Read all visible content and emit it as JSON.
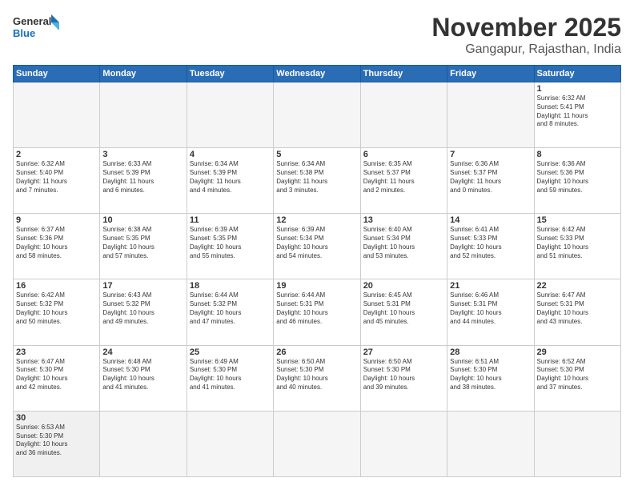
{
  "header": {
    "logo_general": "General",
    "logo_blue": "Blue",
    "month_title": "November 2025",
    "location": "Gangapur, Rajasthan, India"
  },
  "weekdays": [
    "Sunday",
    "Monday",
    "Tuesday",
    "Wednesday",
    "Thursday",
    "Friday",
    "Saturday"
  ],
  "weeks": [
    [
      {
        "day": "",
        "info": ""
      },
      {
        "day": "",
        "info": ""
      },
      {
        "day": "",
        "info": ""
      },
      {
        "day": "",
        "info": ""
      },
      {
        "day": "",
        "info": ""
      },
      {
        "day": "",
        "info": ""
      },
      {
        "day": "1",
        "info": "Sunrise: 6:32 AM\nSunset: 5:41 PM\nDaylight: 11 hours\nand 8 minutes."
      }
    ],
    [
      {
        "day": "2",
        "info": "Sunrise: 6:32 AM\nSunset: 5:40 PM\nDaylight: 11 hours\nand 7 minutes."
      },
      {
        "day": "3",
        "info": "Sunrise: 6:33 AM\nSunset: 5:39 PM\nDaylight: 11 hours\nand 6 minutes."
      },
      {
        "day": "4",
        "info": "Sunrise: 6:34 AM\nSunset: 5:39 PM\nDaylight: 11 hours\nand 4 minutes."
      },
      {
        "day": "5",
        "info": "Sunrise: 6:34 AM\nSunset: 5:38 PM\nDaylight: 11 hours\nand 3 minutes."
      },
      {
        "day": "6",
        "info": "Sunrise: 6:35 AM\nSunset: 5:37 PM\nDaylight: 11 hours\nand 2 minutes."
      },
      {
        "day": "7",
        "info": "Sunrise: 6:36 AM\nSunset: 5:37 PM\nDaylight: 11 hours\nand 0 minutes."
      },
      {
        "day": "8",
        "info": "Sunrise: 6:36 AM\nSunset: 5:36 PM\nDaylight: 10 hours\nand 59 minutes."
      }
    ],
    [
      {
        "day": "9",
        "info": "Sunrise: 6:37 AM\nSunset: 5:36 PM\nDaylight: 10 hours\nand 58 minutes."
      },
      {
        "day": "10",
        "info": "Sunrise: 6:38 AM\nSunset: 5:35 PM\nDaylight: 10 hours\nand 57 minutes."
      },
      {
        "day": "11",
        "info": "Sunrise: 6:39 AM\nSunset: 5:35 PM\nDaylight: 10 hours\nand 55 minutes."
      },
      {
        "day": "12",
        "info": "Sunrise: 6:39 AM\nSunset: 5:34 PM\nDaylight: 10 hours\nand 54 minutes."
      },
      {
        "day": "13",
        "info": "Sunrise: 6:40 AM\nSunset: 5:34 PM\nDaylight: 10 hours\nand 53 minutes."
      },
      {
        "day": "14",
        "info": "Sunrise: 6:41 AM\nSunset: 5:33 PM\nDaylight: 10 hours\nand 52 minutes."
      },
      {
        "day": "15",
        "info": "Sunrise: 6:42 AM\nSunset: 5:33 PM\nDaylight: 10 hours\nand 51 minutes."
      }
    ],
    [
      {
        "day": "16",
        "info": "Sunrise: 6:42 AM\nSunset: 5:32 PM\nDaylight: 10 hours\nand 50 minutes."
      },
      {
        "day": "17",
        "info": "Sunrise: 6:43 AM\nSunset: 5:32 PM\nDaylight: 10 hours\nand 49 minutes."
      },
      {
        "day": "18",
        "info": "Sunrise: 6:44 AM\nSunset: 5:32 PM\nDaylight: 10 hours\nand 47 minutes."
      },
      {
        "day": "19",
        "info": "Sunrise: 6:44 AM\nSunset: 5:31 PM\nDaylight: 10 hours\nand 46 minutes."
      },
      {
        "day": "20",
        "info": "Sunrise: 6:45 AM\nSunset: 5:31 PM\nDaylight: 10 hours\nand 45 minutes."
      },
      {
        "day": "21",
        "info": "Sunrise: 6:46 AM\nSunset: 5:31 PM\nDaylight: 10 hours\nand 44 minutes."
      },
      {
        "day": "22",
        "info": "Sunrise: 6:47 AM\nSunset: 5:31 PM\nDaylight: 10 hours\nand 43 minutes."
      }
    ],
    [
      {
        "day": "23",
        "info": "Sunrise: 6:47 AM\nSunset: 5:30 PM\nDaylight: 10 hours\nand 42 minutes."
      },
      {
        "day": "24",
        "info": "Sunrise: 6:48 AM\nSunset: 5:30 PM\nDaylight: 10 hours\nand 41 minutes."
      },
      {
        "day": "25",
        "info": "Sunrise: 6:49 AM\nSunset: 5:30 PM\nDaylight: 10 hours\nand 41 minutes."
      },
      {
        "day": "26",
        "info": "Sunrise: 6:50 AM\nSunset: 5:30 PM\nDaylight: 10 hours\nand 40 minutes."
      },
      {
        "day": "27",
        "info": "Sunrise: 6:50 AM\nSunset: 5:30 PM\nDaylight: 10 hours\nand 39 minutes."
      },
      {
        "day": "28",
        "info": "Sunrise: 6:51 AM\nSunset: 5:30 PM\nDaylight: 10 hours\nand 38 minutes."
      },
      {
        "day": "29",
        "info": "Sunrise: 6:52 AM\nSunset: 5:30 PM\nDaylight: 10 hours\nand 37 minutes."
      }
    ],
    [
      {
        "day": "30",
        "info": "Sunrise: 6:53 AM\nSunset: 5:30 PM\nDaylight: 10 hours\nand 36 minutes."
      },
      {
        "day": "",
        "info": ""
      },
      {
        "day": "",
        "info": ""
      },
      {
        "day": "",
        "info": ""
      },
      {
        "day": "",
        "info": ""
      },
      {
        "day": "",
        "info": ""
      },
      {
        "day": "",
        "info": ""
      }
    ]
  ]
}
